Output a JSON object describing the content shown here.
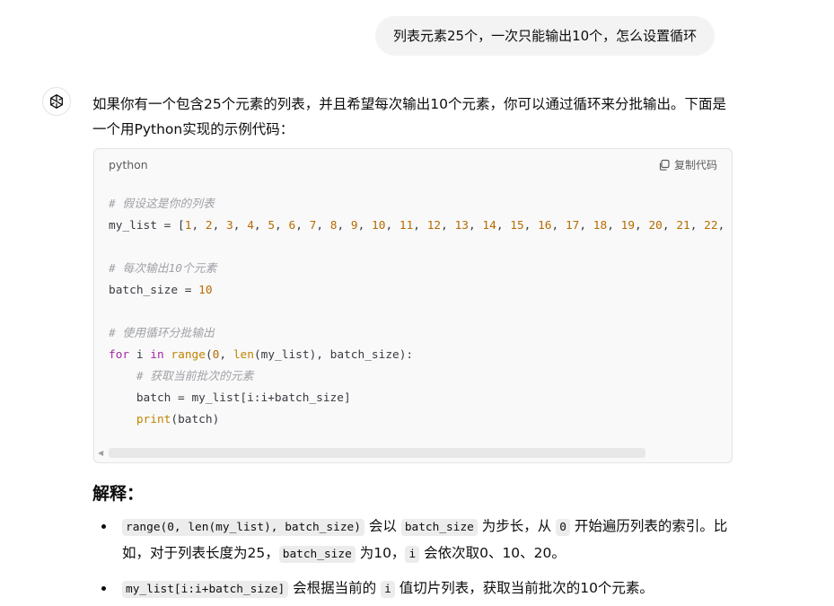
{
  "user_message": "列表元素25个，一次只能输出10个，怎么设置循环",
  "assistant": {
    "intro": "如果你有一个包含25个元素的列表，并且希望每次输出10个元素，你可以通过循环来分批输出。下面是一个用Python实现的示例代码：",
    "code_block": {
      "language": "python",
      "copy_label": "复制代码",
      "lines": {
        "comment1": "# 假设这是你的列表",
        "list_var": "my_list",
        "list_values": [
          "1",
          "2",
          "3",
          "4",
          "5",
          "6",
          "7",
          "8",
          "9",
          "10",
          "11",
          "12",
          "13",
          "14",
          "15",
          "16",
          "17",
          "18",
          "19",
          "20",
          "21",
          "22"
        ],
        "comment2": "# 每次输出10个元素",
        "batch_var": "batch_size",
        "batch_value": "10",
        "comment3": "# 使用循环分批输出",
        "kw_for": "for",
        "loop_var": "i",
        "kw_in": "in",
        "fn_range": "range",
        "range_start": "0",
        "fn_len": "len",
        "range_args_rest": "(my_list), batch_size):",
        "comment4": "# 获取当前批次的元素",
        "batch_assign": "batch = my_list[i:i+batch_size]",
        "fn_print": "print",
        "print_args": "(batch)"
      }
    },
    "explanation_heading": "解释：",
    "bullets": [
      {
        "code1": "range(0, len(my_list), batch_size)",
        "text1": " 会以 ",
        "code2": "batch_size",
        "text2": " 为步长，从 ",
        "code3": "0",
        "text3": " 开始遍历列表的索引。比如，对于列表长度为25，",
        "code4": "batch_size",
        "text4": " 为10，",
        "code5": "i",
        "text5": " 会依次取0、10、20。"
      },
      {
        "code1": "my_list[i:i+batch_size]",
        "text1": " 会根据当前的 ",
        "code2": "i",
        "text2": " 值切片列表，获取当前批次的10个元素。"
      }
    ]
  }
}
